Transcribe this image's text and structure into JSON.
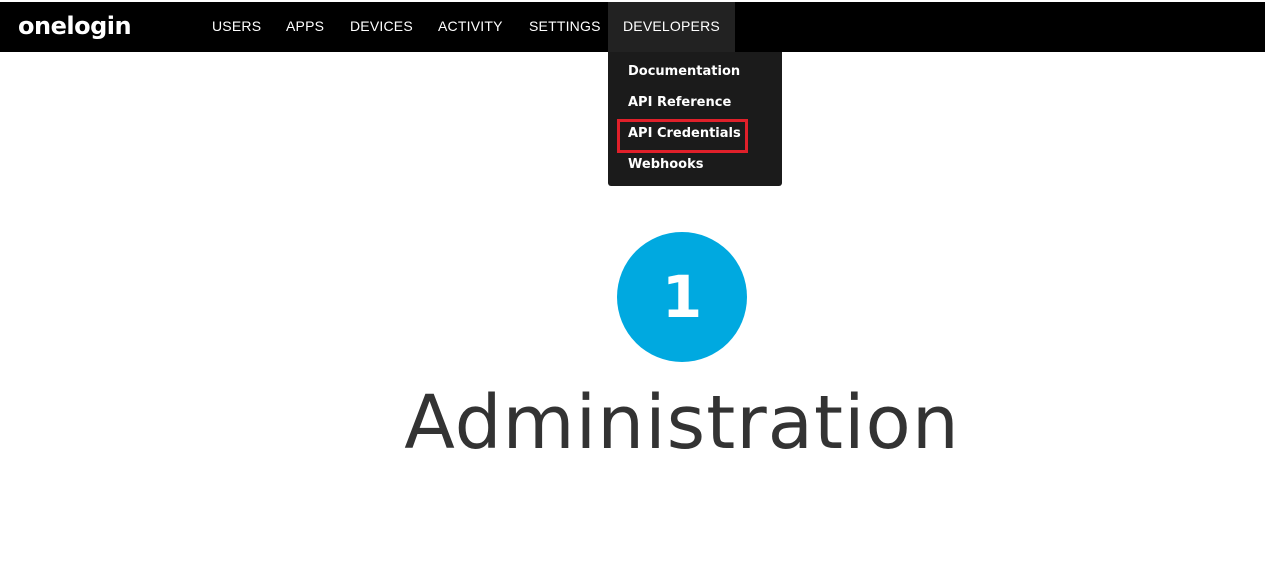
{
  "brand": {
    "logo_text": "onelogin"
  },
  "nav": {
    "items": [
      {
        "label": "USERS"
      },
      {
        "label": "APPS"
      },
      {
        "label": "DEVICES"
      },
      {
        "label": "ACTIVITY"
      },
      {
        "label": "SETTINGS"
      },
      {
        "label": "DEVELOPERS"
      }
    ],
    "active": "DEVELOPERS"
  },
  "developers_menu": {
    "items": [
      {
        "label": "Documentation"
      },
      {
        "label": "API Reference"
      },
      {
        "label": "API Credentials"
      },
      {
        "label": "Webhooks"
      }
    ],
    "highlighted": "API Credentials"
  },
  "main": {
    "step_number": "1",
    "title": "Administration"
  },
  "colors": {
    "navbar": "#000000",
    "dropdown": "#1b1b1b",
    "highlight": "#e0202a",
    "step_circle": "#00a9e0",
    "title_text": "#333333"
  }
}
